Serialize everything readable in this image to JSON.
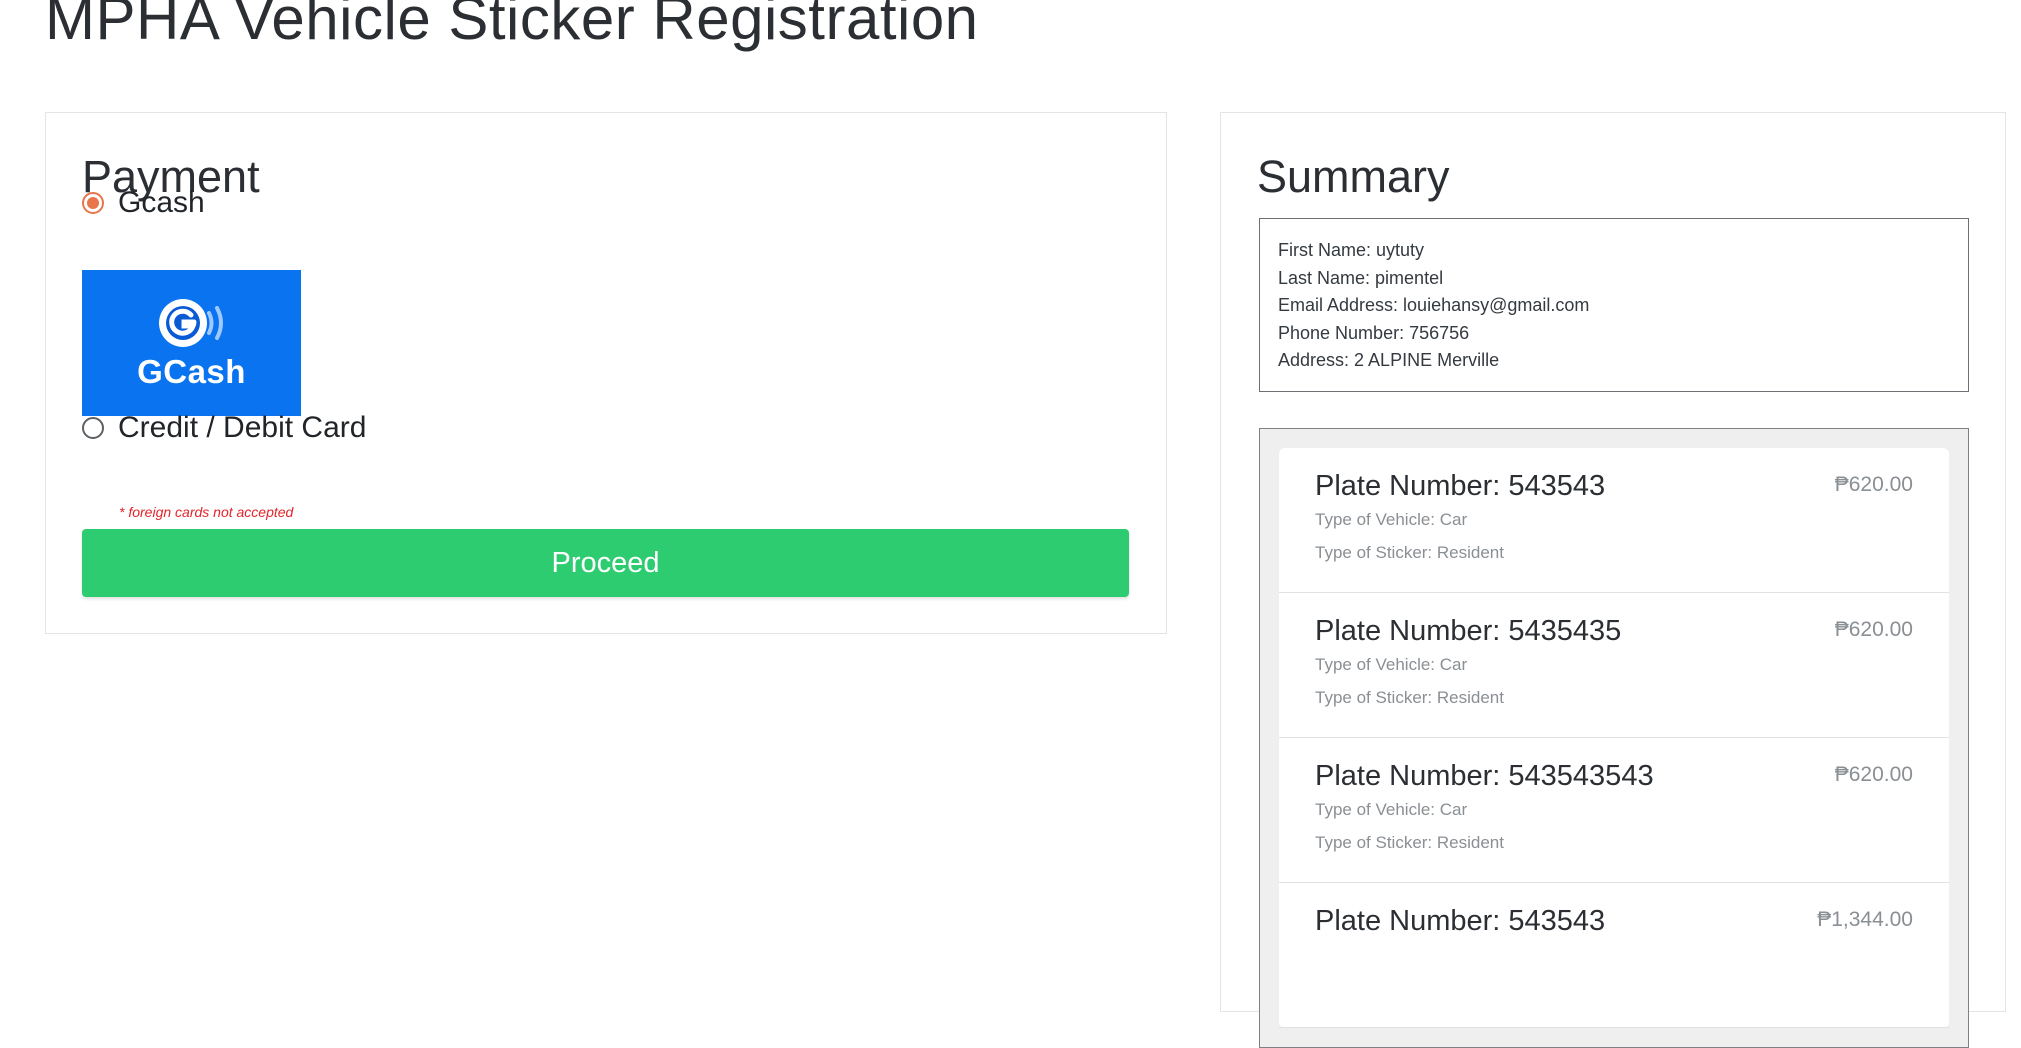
{
  "page": {
    "title": "MPHA Vehicle Sticker Registration"
  },
  "payment": {
    "heading": "Payment",
    "options": [
      {
        "label": "Gcash",
        "selected": true
      },
      {
        "label": "Credit / Debit Card",
        "selected": false
      }
    ],
    "gcash_logo_text": "GCash",
    "note": "* foreign cards not accepted",
    "proceed_label": "Proceed"
  },
  "summary": {
    "heading": "Summary",
    "info": [
      "First Name: uytuty",
      "Last Name: pimentel",
      "Email Address: louiehansy@gmail.com",
      "Phone Number: 756756",
      "Address: 2 ALPINE Merville"
    ],
    "vehicles": [
      {
        "plate": "Plate Number: 543543",
        "price": "₱620.00",
        "vehicle_type": "Type of Vehicle: Car",
        "sticker_type": "Type of Sticker: Resident"
      },
      {
        "plate": "Plate Number: 5435435",
        "price": "₱620.00",
        "vehicle_type": "Type of Vehicle: Car",
        "sticker_type": "Type of Sticker: Resident"
      },
      {
        "plate": "Plate Number: 543543543",
        "price": "₱620.00",
        "vehicle_type": "Type of Vehicle: Car",
        "sticker_type": "Type of Sticker: Resident"
      },
      {
        "plate": "Plate Number: 543543",
        "price": "₱1,344.00",
        "vehicle_type": "",
        "sticker_type": ""
      }
    ]
  },
  "colors": {
    "accent_radio": "#e8764a",
    "proceed_green": "#2ecc71",
    "gcash_blue": "#0a74f0",
    "note_red": "#e3242b"
  },
  "icons": [
    "radio-checked-icon",
    "radio-unchecked-icon",
    "gcash-logo-icon"
  ]
}
